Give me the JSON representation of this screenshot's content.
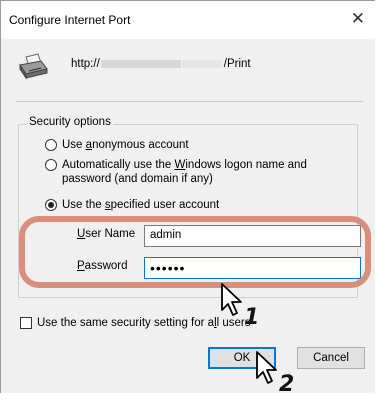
{
  "window": {
    "title": "Configure Internet Port",
    "close_glyph": "✕"
  },
  "port": {
    "url_prefix": "http://",
    "url_suffix": "/Print"
  },
  "security": {
    "group_label": "Security options",
    "options": [
      {
        "label_pre": "Use ",
        "label_u": "a",
        "label_post": "nonymous account",
        "checked": false
      },
      {
        "label_pre": "Automatically use the ",
        "label_u": "W",
        "label_post": "indows logon name and password (and domain if any)",
        "checked": false
      },
      {
        "label_pre": "Use the ",
        "label_u": "s",
        "label_post": "pecified user account",
        "checked": true
      }
    ],
    "username_label_u": "U",
    "username_label_post": "ser Name",
    "username_value": "admin",
    "password_label_u": "P",
    "password_label_post": "assword",
    "password_value": "••••••"
  },
  "same_setting": {
    "label_pre": "Use the same security setting for a",
    "label_u": "l",
    "label_post": "l users",
    "checked": false
  },
  "buttons": {
    "ok": "OK",
    "cancel": "Cancel"
  },
  "callouts": {
    "step1": "1",
    "step2": "2"
  },
  "colors": {
    "highlight": "#d98f7c",
    "focus": "#0078d7"
  }
}
